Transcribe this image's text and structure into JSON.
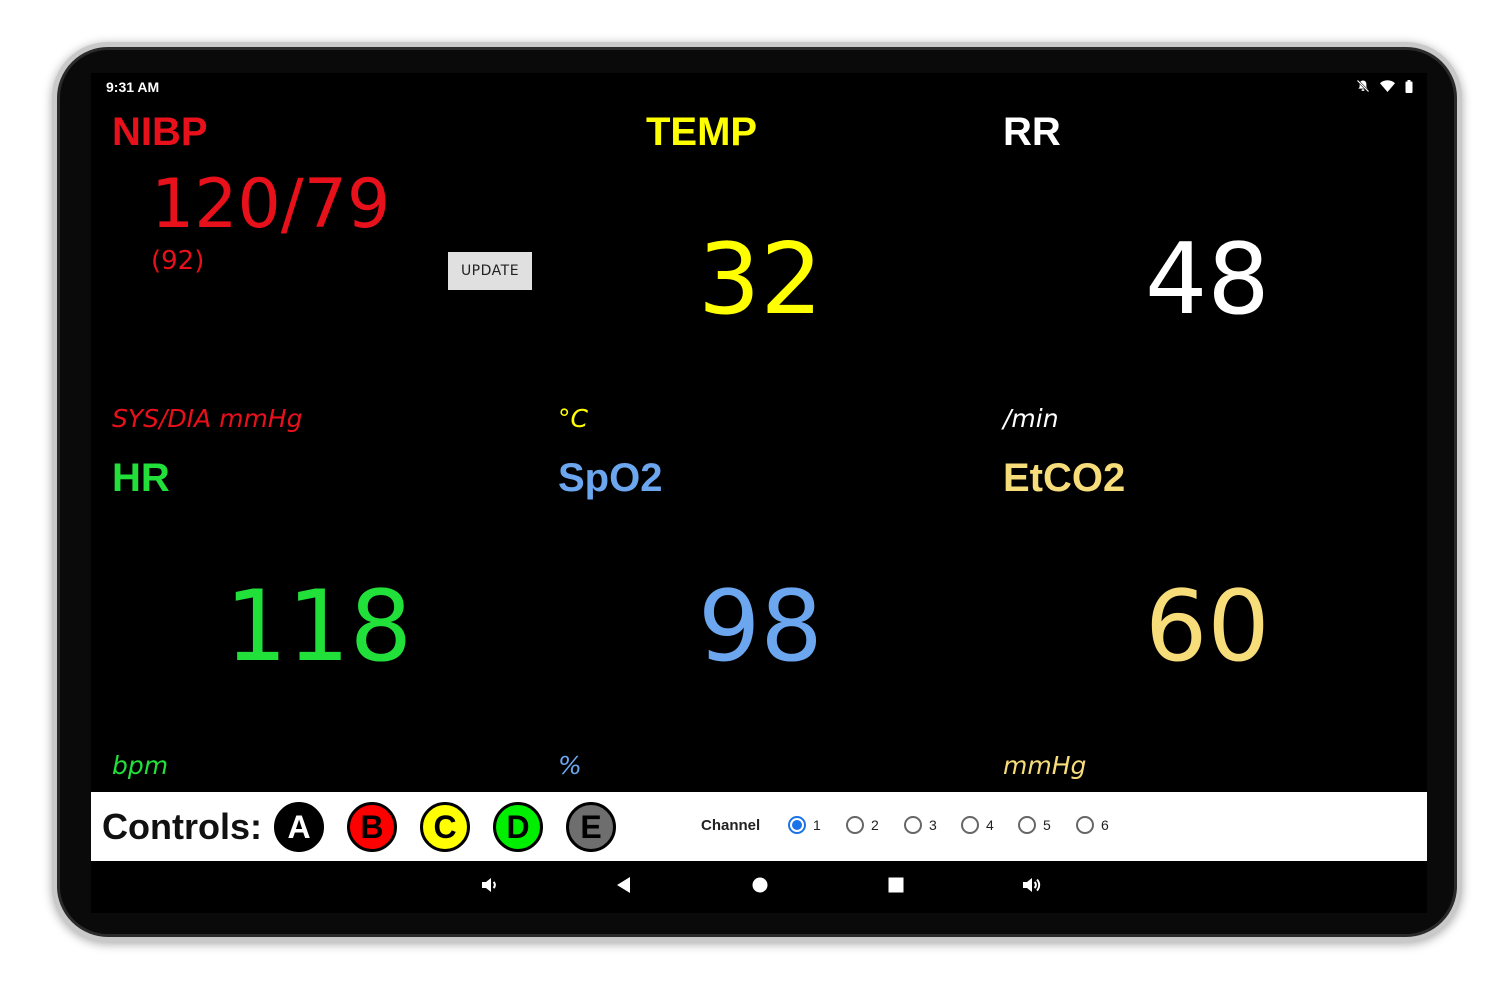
{
  "status": {
    "time": "9:31 AM"
  },
  "nibp": {
    "label": "NIBP",
    "value": "120/79",
    "mean": "(92)",
    "unit": "SYS/DIA mmHg",
    "update_label": "UPDATE",
    "color": "#e8101a"
  },
  "temp": {
    "label": "TEMP",
    "value": "32",
    "unit": "°C",
    "color": "#ffff00"
  },
  "rr": {
    "label": "RR",
    "value": "48",
    "unit": "/min",
    "color": "#ffffff"
  },
  "hr": {
    "label": "HR",
    "value": "118",
    "unit": "bpm",
    "color": "#22e03a"
  },
  "spo2": {
    "label": "SpO2",
    "value": "98",
    "unit": "%",
    "color": "#6ba6ef"
  },
  "etco2": {
    "label": "EtCO2",
    "value": "60",
    "unit": "mmHg",
    "color": "#f7dc7a"
  },
  "controls": {
    "label": "Controls:",
    "buttons": [
      {
        "label": "A",
        "bg": "#000000",
        "fg": "#ffffff"
      },
      {
        "label": "B",
        "bg": "#ff0000",
        "fg": "#000000"
      },
      {
        "label": "C",
        "bg": "#ffff00",
        "fg": "#000000"
      },
      {
        "label": "D",
        "bg": "#00ee00",
        "fg": "#000000"
      },
      {
        "label": "E",
        "bg": "#6e6e6e",
        "fg": "#000000"
      }
    ],
    "channel_label": "Channel",
    "channels": [
      "1",
      "2",
      "3",
      "4",
      "5",
      "6"
    ],
    "selected_channel": "1"
  },
  "nav": {
    "icons": [
      "volume-down-icon",
      "back-icon",
      "home-icon",
      "recents-icon",
      "volume-up-icon"
    ]
  }
}
